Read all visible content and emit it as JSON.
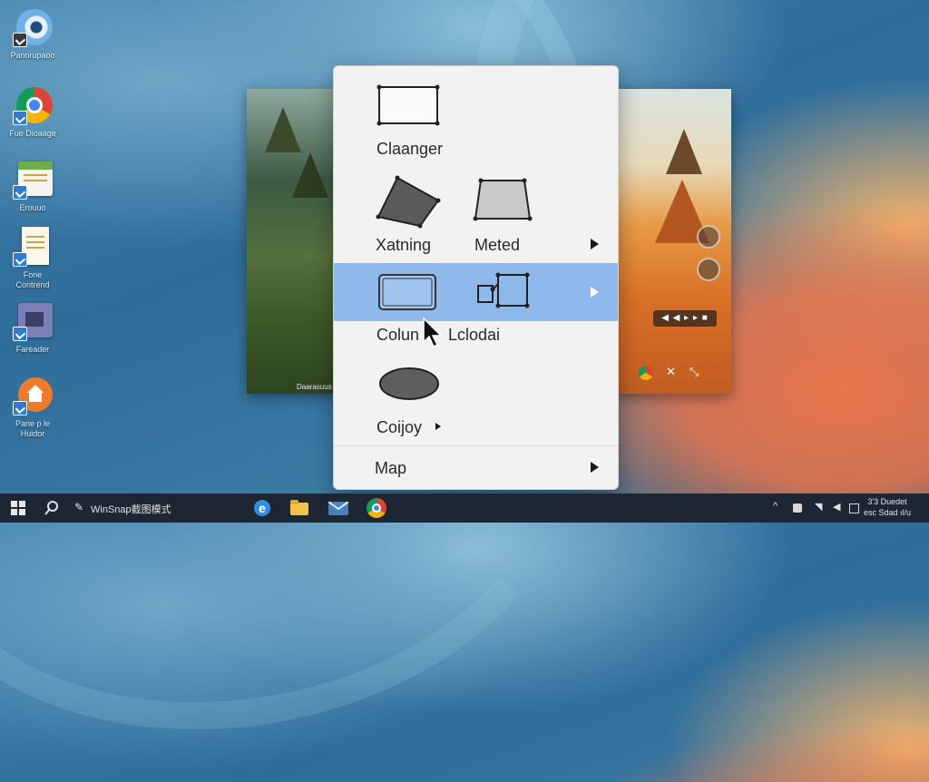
{
  "desktop": {
    "icons": [
      {
        "label": "Panorupaoo",
        "icon": "disc-icon"
      },
      {
        "label": "Fue Dioaage",
        "icon": "chrome-icon"
      },
      {
        "label": "Erouuo",
        "icon": "calendar-icon"
      },
      {
        "label": "Fone Contrend",
        "icon": "document-icon"
      },
      {
        "label": "Fareader",
        "icon": "reader-icon"
      },
      {
        "label": "Pane p le\nHuidor",
        "icon": "home-icon"
      }
    ]
  },
  "background_window": {
    "caption": "Daarasuus",
    "controls_label": "◀ ◀ ▸ ▸ ■"
  },
  "context_menu": {
    "items": [
      {
        "label": "Claanger",
        "shape": "rectangle-icon",
        "has_submenu": false
      },
      {
        "label": "Xatning",
        "shape": "skewed-quad-icon",
        "has_submenu": false
      },
      {
        "label": "Meted",
        "shape": "trapezoid-icon",
        "has_submenu": true
      },
      {
        "label": "Colun",
        "shape": "rounded-rectangle-icon",
        "has_submenu": true,
        "highlighted": true
      },
      {
        "label": "Lclodai",
        "shape": "connected-boxes-icon",
        "has_submenu": false
      },
      {
        "label": "Coijoy",
        "shape": "ellipse-icon",
        "has_submenu": true
      },
      {
        "label": "Map",
        "shape": null,
        "has_submenu": true
      }
    ],
    "highlight_color": "#8fb9ea"
  },
  "taskbar": {
    "app_label": "WinSnap截图模式",
    "pinned": [
      "edge-icon",
      "file-explorer-icon",
      "mail-icon",
      "chrome-icon"
    ],
    "clock": {
      "line1": "3'3 Duedet",
      "line2": "esc Sdad ıl/u"
    }
  },
  "colors": {
    "taskbar": "#1c2733",
    "menu_bg": "#f2f2f2",
    "accent": "#8fb9ea"
  }
}
